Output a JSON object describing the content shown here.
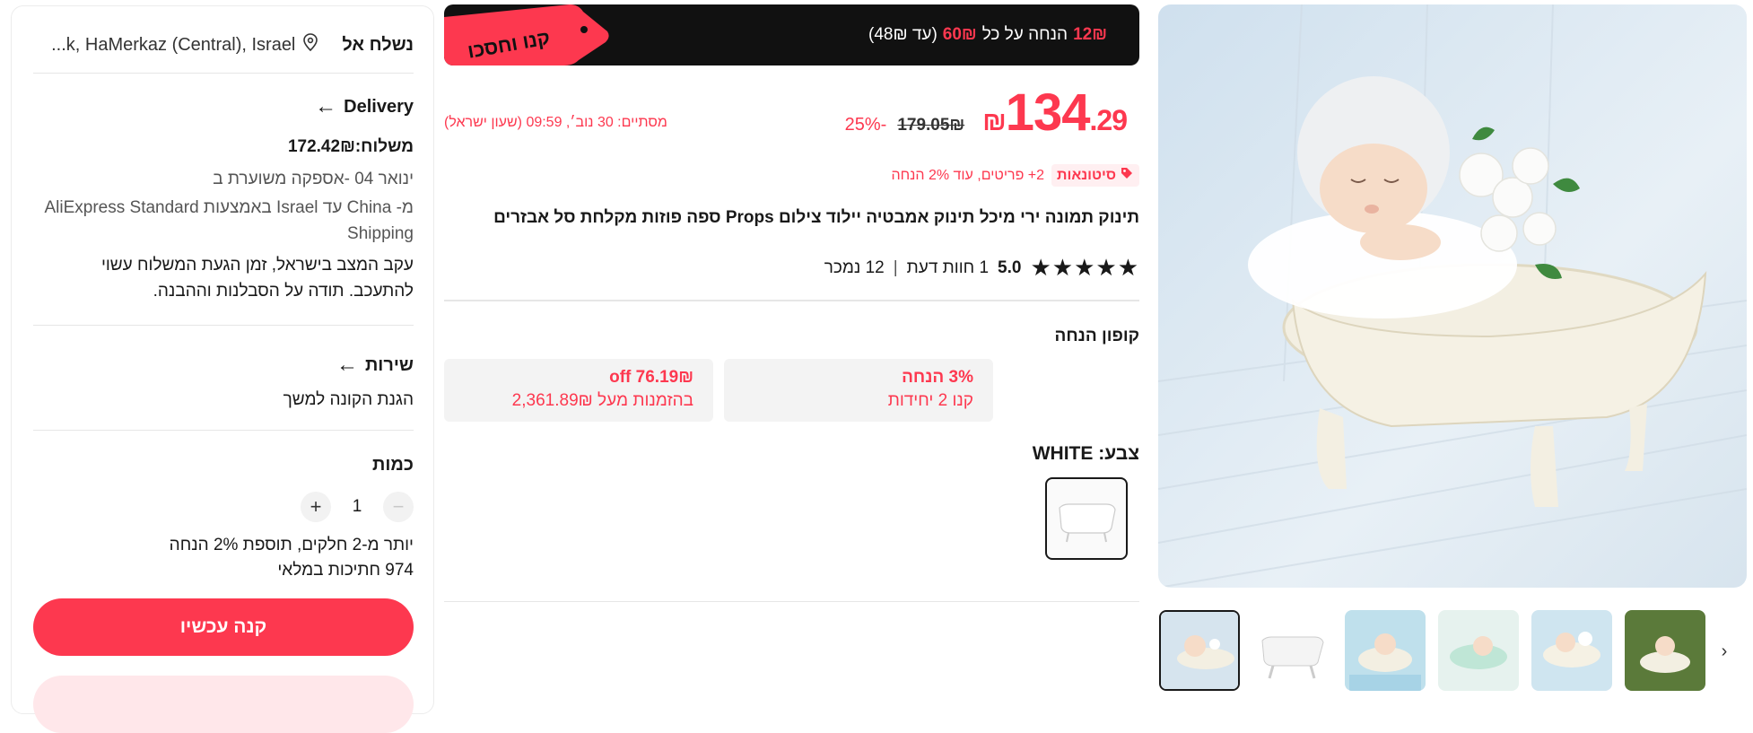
{
  "shipping": {
    "ship_to_label": "נשלח אל",
    "location": "...k, HaMerkaz (Central), Israel"
  },
  "delivery": {
    "title": "Delivery",
    "cost": "משלוח:172.42₪",
    "estimate": "ינואר 04 -אספקה משוערת ב",
    "route": "מ- China עד Israel באמצעות AliExpress Standard Shipping",
    "notice": "עקב המצב בישראל, זמן הגעת המשלוח עשוי להתעכב. תודה על הסבלנות וההבנה."
  },
  "service": {
    "title": "שירות",
    "text": "הגנת הקונה למשך"
  },
  "quantity": {
    "title": "כמות",
    "value": "1",
    "minus": "−",
    "plus": "+",
    "discount_note": "יותר מ-2 חלקים, תוספת 2% הנחה",
    "stock": "974 חתיכות במלאי"
  },
  "buttons": {
    "buy_now": "קנה עכשיו"
  },
  "banner": {
    "tag": "קנו וחסכו",
    "amount": "12₪",
    "text_mid": "הנחה על כל",
    "threshold": "60₪",
    "cap": "(עד 48₪)"
  },
  "price": {
    "currency": "₪",
    "whole": "134",
    "decimal": ".29",
    "original": "179.05₪",
    "discount": "-25%",
    "ends": "מסתיים: 30 נוב׳, 09:59 (שעון ישראל)"
  },
  "wholesale": {
    "badge": "סיטונאות",
    "text": "2+ פריטים, עוד 2% הנחה"
  },
  "product": {
    "title": "תינוק תמונה ירי מיכל תינוק אמבטיה יילוד צילום Props ספה פוזות מקלחת סל אבזרים",
    "rating": "5.0",
    "reviews": "1 חוות דעת",
    "separator": "|",
    "sold": "12 נמכר",
    "stars": "★★★★★"
  },
  "coupons": {
    "title": "קופון הנחה",
    "items": [
      {
        "line1": "3% הנחה",
        "line2": "קנו 2 יחידות"
      },
      {
        "line1": "76.19₪ off",
        "line2": "בהזמנות מעל 2,361.89₪"
      }
    ]
  },
  "color": {
    "label": "צבע: WHITE"
  },
  "gallery": {
    "next": "›"
  },
  "colors": {
    "accent": "#fd384f",
    "banner_bg": "#111111",
    "coupon_bg": "#f3f3f3"
  }
}
